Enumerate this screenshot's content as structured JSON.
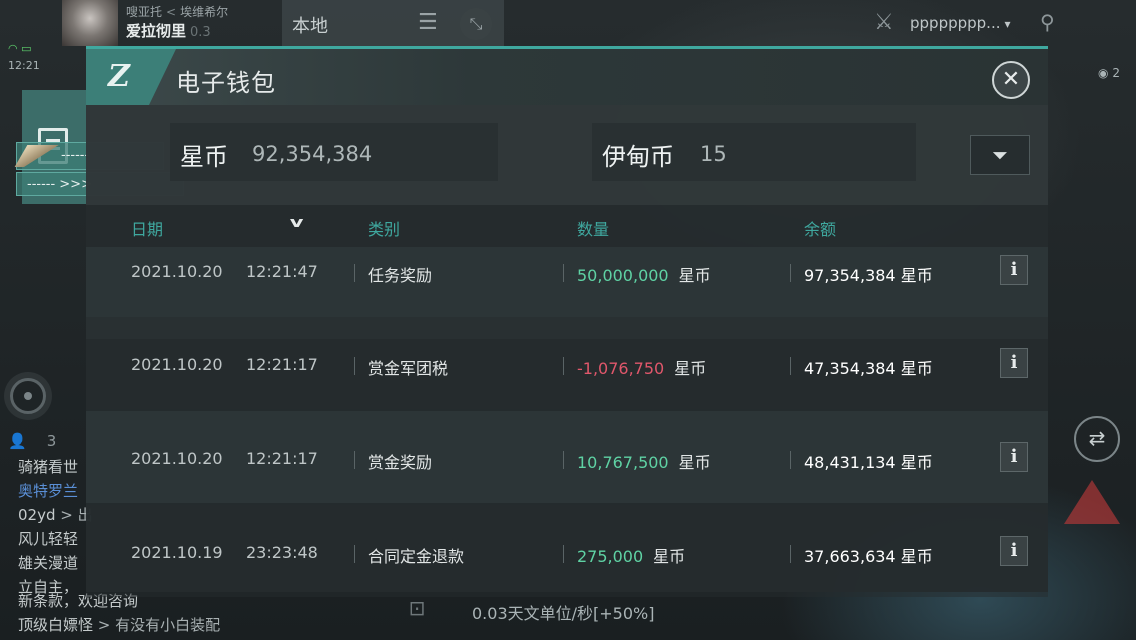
{
  "hud": {
    "pilot_corp": "嗖亚托",
    "pilot_corp_sep": "<",
    "pilot_alliance": "埃维希尔",
    "pilot_name": "爱拉彻里",
    "pilot_security": "0.3",
    "clock": "12:21",
    "local_tab": "本地",
    "ship_name": "pppppppp...",
    "right_counter": "2",
    "speed": "0.03天文单位/秒[+50%]"
  },
  "side": {
    "ship_label_1": "------",
    "ship_label_2": "------ >>>"
  },
  "chat": {
    "user_count": "3",
    "lines": [
      {
        "name": "骑猪看世",
        "text": ""
      },
      {
        "name": "奥特罗兰",
        "text": ""
      },
      {
        "name": "02yd",
        "text": " > 出"
      },
      {
        "name": "风儿轻轻",
        "text": ""
      },
      {
        "name": "雄关漫道",
        "text": ""
      },
      {
        "name": "立自主，",
        "text": ""
      },
      {
        "name": "新条款，欢迎咨询",
        "text": ""
      },
      {
        "name": "顶级白嫖怪",
        "text": " > 有没有小白装配"
      }
    ]
  },
  "wallet": {
    "title": "电子钱包",
    "coin_label": "星币",
    "coin_value": "92,354,384",
    "isk_label": "伊甸币",
    "isk_value": "15",
    "columns": {
      "date": "日期",
      "category": "类别",
      "amount": "数量",
      "balance": "余额"
    },
    "transactions": [
      {
        "date": "2021.10.20",
        "time": "12:21:47",
        "category": "任务奖励",
        "amount": "50,000,000",
        "unit": "星币",
        "balance": "97,354,384 星币",
        "sign": "positive"
      },
      {
        "date": "2021.10.20",
        "time": "12:21:17",
        "category": "赏金军团税",
        "amount": "-1,076,750",
        "unit": "星币",
        "balance": "47,354,384 星币",
        "sign": "negative"
      },
      {
        "date": "2021.10.20",
        "time": "12:21:17",
        "category": "赏金奖励",
        "amount": "10,767,500",
        "unit": "星币",
        "balance": "48,431,134 星币",
        "sign": "positive"
      },
      {
        "date": "2021.10.19",
        "time": "23:23:48",
        "category": "合同定金退款",
        "amount": "275,000",
        "unit": "星币",
        "balance": "37,663,634 星币",
        "sign": "positive"
      }
    ]
  },
  "colors": {
    "accent": "#3fa89f",
    "positive": "#5fd2a4",
    "negative": "#e0576b"
  }
}
